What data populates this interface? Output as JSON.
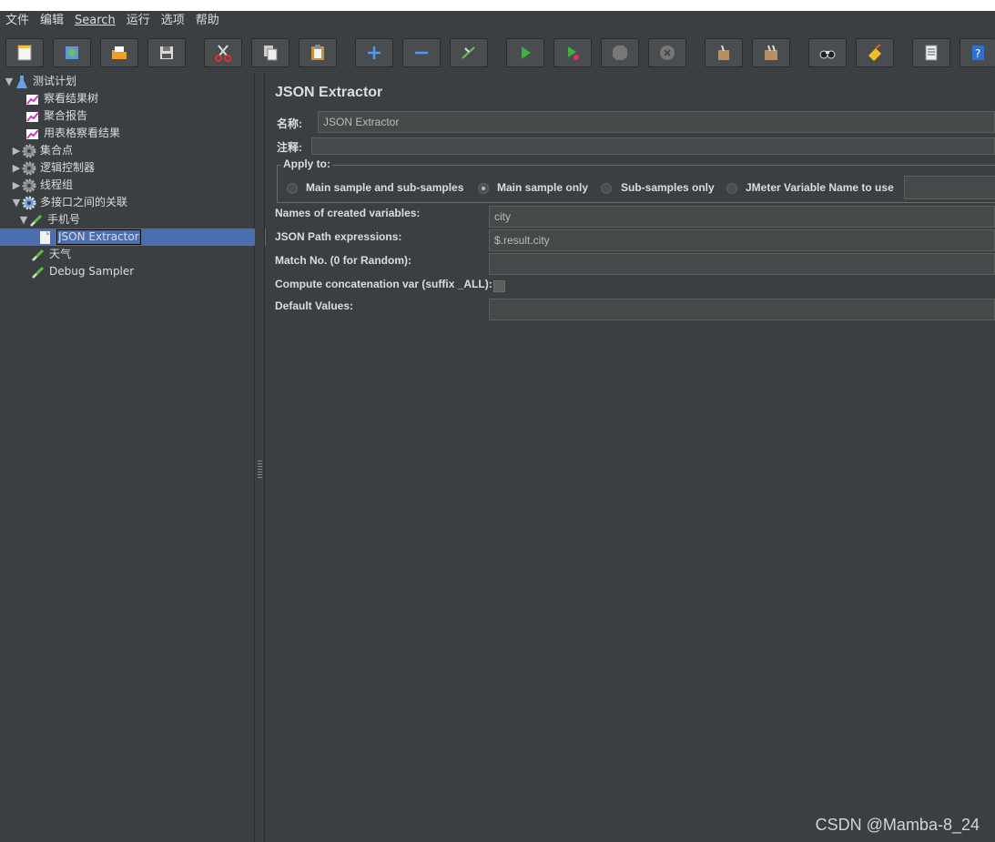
{
  "menu": [
    "文件",
    "编辑",
    "Search",
    "运行",
    "选项",
    "帮助"
  ],
  "toolbar": {
    "buttons": [
      "new-icon",
      "templates-icon",
      "open-icon",
      "save-icon",
      "cut-icon",
      "copy-icon",
      "paste-icon",
      "expand-icon",
      "collapse-icon",
      "toggle-icon",
      "start-icon",
      "start-no-pause-icon",
      "stop-icon",
      "shutdown-icon",
      "clear-icon",
      "clear-all-icon",
      "search-icon",
      "reset-search-icon",
      "function-helper-icon",
      "help-icon"
    ]
  },
  "tree": {
    "items": [
      {
        "label": "测试计划"
      },
      {
        "label": "察看结果树"
      },
      {
        "label": "聚合报告"
      },
      {
        "label": "用表格察看结果"
      },
      {
        "label": "集合点"
      },
      {
        "label": "逻辑控制器"
      },
      {
        "label": "线程组"
      },
      {
        "label": "多接口之间的关联"
      },
      {
        "label": "手机号"
      },
      {
        "label": "JSON Extractor"
      },
      {
        "label": "天气"
      },
      {
        "label": "Debug Sampler"
      }
    ]
  },
  "panel": {
    "title": "JSON Extractor",
    "name_label": "名称:",
    "name_value": "JSON Extractor",
    "comment_label": "注释:",
    "comment_value": "",
    "apply_to": {
      "title": "Apply to:",
      "options": [
        "Main sample and sub-samples",
        "Main sample only",
        "Sub-samples only",
        "JMeter Variable Name to use"
      ],
      "selected": "Main sample only",
      "variable_name_value": ""
    },
    "fields": {
      "names_label": "Names of created variables:",
      "names_value": "city",
      "paths_label": "JSON Path expressions:",
      "paths_value": "$.result.city",
      "match_label": "Match No. (0 for Random):",
      "match_value": "",
      "concat_label": "Compute concatenation var (suffix _ALL):",
      "default_label": "Default Values:",
      "default_value": ""
    }
  },
  "watermark": "CSDN @Mamba-8_24",
  "colors": {
    "background": "#3c3f41",
    "selection": "#4b6eaf",
    "field": "#45494a"
  }
}
